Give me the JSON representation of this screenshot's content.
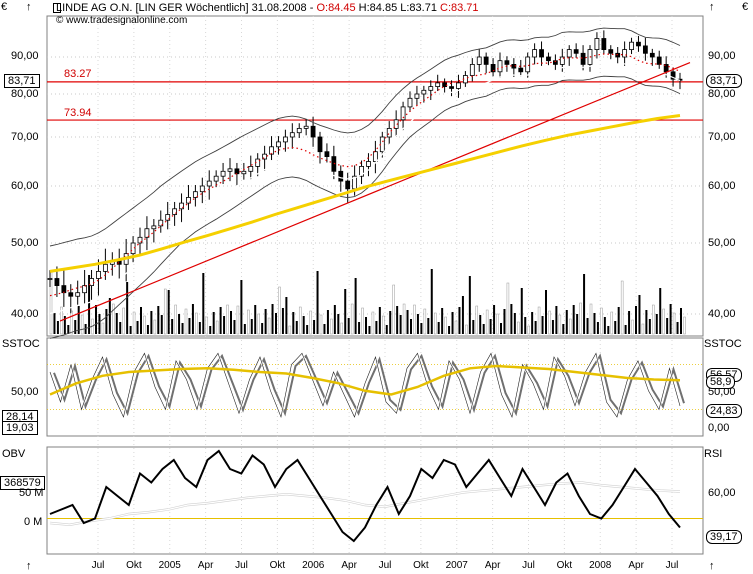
{
  "header": {
    "title": "LINDE AG O.N. [LIN GER  Wöchentlich] 31.08.2008 - ",
    "open": "O:84.45",
    "high": "H:84.85",
    "low": "L:83.71",
    "close": "C:83.71",
    "copyright": "www.tradesignalonline.com",
    "currency_left": "€",
    "currency_right": "€"
  },
  "panels": {
    "price": {
      "price_tag": "83,71",
      "line_upper_label": "83.27",
      "line_lower_label": "73.94",
      "y_ticks": [
        "90,00",
        "80,00",
        "70,00",
        "60,00",
        "50,00",
        "40,00"
      ]
    },
    "sstoc": {
      "name": "SSTOC",
      "y_ticks": [
        "50,00",
        "0,00"
      ],
      "left_values": [
        "28,14",
        "19,03"
      ],
      "right_values": [
        "58,9",
        "56,57",
        "24,83"
      ]
    },
    "obv": {
      "name": "OBV",
      "name_right": "RSI",
      "y_ticks_left": [
        "50 M",
        "0 M"
      ],
      "y_ticks_right": [
        "60,00",
        "40,00"
      ],
      "left_value": "368579",
      "right_value": "39,17"
    }
  },
  "x_axis": [
    "Jul",
    "Okt",
    "2005",
    "Apr",
    "Jul",
    "Okt",
    "2006",
    "Apr",
    "Jul",
    "Okt",
    "2007",
    "Apr",
    "Jul",
    "Okt",
    "2008",
    "Apr",
    "Jul"
  ],
  "colors": {
    "hline": "#e00000",
    "trend": "#e00000",
    "ma200": "#f5d000",
    "sstoc_ma": "#e6c000",
    "obv": "#000000",
    "rsi": "#ffffff",
    "panel_bg": "#ffffff"
  },
  "chart_data": [
    {
      "type": "line",
      "title": "LINDE AG O.N. [LIN GER  Wöchentlich] 31.08.2008",
      "ylim": [
        38,
        98
      ],
      "hlines": [
        83.27,
        73.94
      ],
      "close": [
        45,
        44,
        43,
        42.5,
        43,
        44,
        45,
        46,
        47,
        47.5,
        47,
        48.5,
        50,
        51,
        52.5,
        53,
        54,
        55,
        56,
        57,
        58,
        59,
        60,
        61,
        62,
        63,
        63.5,
        62.5,
        63,
        64,
        65.5,
        66.5,
        68,
        69,
        70,
        71,
        72,
        72.5,
        70,
        67,
        66,
        63,
        61,
        59.5,
        62,
        64,
        65,
        67,
        70,
        72,
        74,
        77,
        79,
        80,
        81,
        82,
        83,
        82,
        81.5,
        83,
        85,
        88,
        90,
        88,
        86,
        89,
        88,
        87,
        86,
        90,
        92,
        90,
        89,
        88,
        90,
        92,
        91,
        88,
        92,
        95,
        92,
        91,
        90,
        92,
        94,
        93,
        91,
        90,
        88,
        86,
        84,
        83.71
      ],
      "ma200": [
        46,
        46.5,
        47,
        47.6,
        48.3,
        49.2,
        50.2,
        51.3,
        52.5,
        53.7,
        55,
        56.2,
        57.4,
        58.6,
        59.8,
        61,
        62.2,
        63.4,
        64.6,
        65.8,
        67,
        68.2,
        69.3,
        70.4,
        71.4,
        72.4,
        73.4,
        74.3,
        75
      ]
    },
    {
      "type": "line",
      "title": "SSTOC",
      "ylim": [
        -10,
        110
      ],
      "hlines": [
        80,
        20
      ],
      "stoch": [
        70,
        30,
        80,
        20,
        60,
        90,
        40,
        10,
        70,
        95,
        50,
        20,
        85,
        60,
        20,
        75,
        95,
        55,
        15,
        60,
        90,
        45,
        10,
        80,
        95,
        60,
        25,
        70,
        40,
        10,
        55,
        90,
        30,
        15,
        75,
        95,
        50,
        20,
        85,
        60,
        15,
        70,
        95,
        40,
        10,
        80,
        55,
        20,
        90,
        65,
        25,
        70,
        95,
        30,
        10,
        60,
        85,
        45,
        20,
        75,
        24.83
      ],
      "signal_ma": [
        40,
        55,
        65,
        70,
        72,
        74,
        75,
        73,
        70,
        68,
        62,
        55,
        45,
        40,
        50,
        65,
        75,
        78,
        76,
        74,
        70,
        66,
        62,
        60,
        58.9
      ]
    },
    {
      "type": "line",
      "title": "OBV / RSI",
      "obv": [
        10,
        15,
        20,
        0,
        5,
        40,
        30,
        20,
        55,
        45,
        60,
        70,
        50,
        40,
        70,
        80,
        60,
        55,
        75,
        65,
        40,
        60,
        70,
        50,
        30,
        10,
        -10,
        -20,
        -5,
        20,
        40,
        10,
        30,
        60,
        50,
        70,
        65,
        40,
        55,
        70,
        50,
        30,
        60,
        40,
        20,
        45,
        55,
        30,
        10,
        5,
        20,
        40,
        60,
        45,
        30,
        10,
        -5
      ],
      "rsi": [
        30,
        28,
        32,
        35,
        40,
        42,
        45,
        50,
        52,
        55,
        58,
        60,
        62,
        60,
        58,
        55,
        50,
        48,
        52,
        56,
        60,
        64,
        66,
        68,
        70,
        72,
        74,
        75,
        72,
        70,
        68,
        66,
        65
      ]
    }
  ]
}
